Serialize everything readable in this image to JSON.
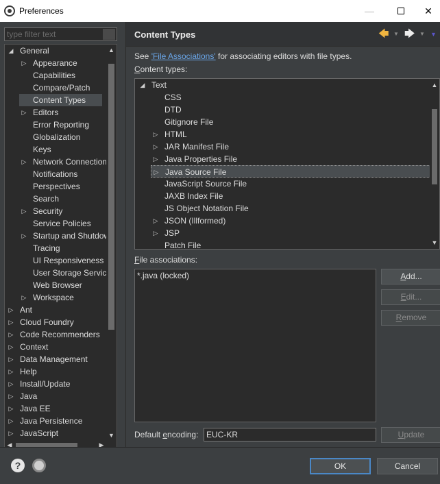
{
  "window": {
    "title": "Preferences",
    "minimize": "—",
    "close": "✕"
  },
  "filter": {
    "placeholder": "type filter text"
  },
  "tree": {
    "items": [
      {
        "label": "General",
        "expander": "expanded",
        "indent": 0
      },
      {
        "label": "Appearance",
        "expander": "collapsed",
        "indent": 1
      },
      {
        "label": "Capabilities",
        "expander": "none",
        "indent": 1
      },
      {
        "label": "Compare/Patch",
        "expander": "none",
        "indent": 1
      },
      {
        "label": "Content Types",
        "expander": "none",
        "indent": 1,
        "selected": true
      },
      {
        "label": "Editors",
        "expander": "collapsed",
        "indent": 1
      },
      {
        "label": "Error Reporting",
        "expander": "none",
        "indent": 1
      },
      {
        "label": "Globalization",
        "expander": "none",
        "indent": 1
      },
      {
        "label": "Keys",
        "expander": "none",
        "indent": 1
      },
      {
        "label": "Network Connections",
        "expander": "collapsed",
        "indent": 1
      },
      {
        "label": "Notifications",
        "expander": "none",
        "indent": 1
      },
      {
        "label": "Perspectives",
        "expander": "none",
        "indent": 1
      },
      {
        "label": "Search",
        "expander": "none",
        "indent": 1
      },
      {
        "label": "Security",
        "expander": "collapsed",
        "indent": 1
      },
      {
        "label": "Service Policies",
        "expander": "none",
        "indent": 1
      },
      {
        "label": "Startup and Shutdown",
        "expander": "collapsed",
        "indent": 1
      },
      {
        "label": "Tracing",
        "expander": "none",
        "indent": 1
      },
      {
        "label": "UI Responsiveness Monitoring",
        "expander": "none",
        "indent": 1
      },
      {
        "label": "User Storage Service",
        "expander": "none",
        "indent": 1
      },
      {
        "label": "Web Browser",
        "expander": "none",
        "indent": 1
      },
      {
        "label": "Workspace",
        "expander": "collapsed",
        "indent": 1
      },
      {
        "label": "Ant",
        "expander": "collapsed",
        "indent": 0
      },
      {
        "label": "Cloud Foundry",
        "expander": "collapsed",
        "indent": 0
      },
      {
        "label": "Code Recommenders",
        "expander": "collapsed",
        "indent": 0
      },
      {
        "label": "Context",
        "expander": "collapsed",
        "indent": 0
      },
      {
        "label": "Data Management",
        "expander": "collapsed",
        "indent": 0
      },
      {
        "label": "Help",
        "expander": "collapsed",
        "indent": 0
      },
      {
        "label": "Install/Update",
        "expander": "collapsed",
        "indent": 0
      },
      {
        "label": "Java",
        "expander": "collapsed",
        "indent": 0
      },
      {
        "label": "Java EE",
        "expander": "collapsed",
        "indent": 0
      },
      {
        "label": "Java Persistence",
        "expander": "collapsed",
        "indent": 0
      },
      {
        "label": "JavaScript",
        "expander": "collapsed",
        "indent": 0
      }
    ]
  },
  "page": {
    "title": "Content Types",
    "desc_prefix": "See ",
    "desc_link": "'File Associations'",
    "desc_suffix": " for associating editors with file types.",
    "content_types_label_u": "C",
    "content_types_label_rest": "ontent types:",
    "file_assoc_label_u": "F",
    "file_assoc_label_rest": "ile associations:",
    "encoding_label_pre": "Default ",
    "encoding_label_u": "e",
    "encoding_label_rest": "ncoding:",
    "encoding_value": "EUC-KR"
  },
  "content_types": [
    {
      "label": "Text",
      "expander": "expanded",
      "indent": 0
    },
    {
      "label": "CSS",
      "expander": "none",
      "indent": 1
    },
    {
      "label": "DTD",
      "expander": "none",
      "indent": 1
    },
    {
      "label": "Gitignore File",
      "expander": "none",
      "indent": 1
    },
    {
      "label": "HTML",
      "expander": "collapsed",
      "indent": 1
    },
    {
      "label": "JAR Manifest File",
      "expander": "collapsed",
      "indent": 1
    },
    {
      "label": "Java Properties File",
      "expander": "collapsed",
      "indent": 1
    },
    {
      "label": "Java Source File",
      "expander": "collapsed",
      "indent": 1,
      "selected": true
    },
    {
      "label": "JavaScript Source File",
      "expander": "none",
      "indent": 1
    },
    {
      "label": "JAXB Index File",
      "expander": "none",
      "indent": 1
    },
    {
      "label": "JS Object Notation File",
      "expander": "none",
      "indent": 1
    },
    {
      "label": "JSON (Illformed)",
      "expander": "collapsed",
      "indent": 1
    },
    {
      "label": "JSP",
      "expander": "collapsed",
      "indent": 1
    },
    {
      "label": "Patch File",
      "expander": "none",
      "indent": 1
    }
  ],
  "file_associations": [
    "*.java (locked)"
  ],
  "buttons": {
    "add_u": "A",
    "add_rest": "dd...",
    "edit_u": "E",
    "edit_rest": "dit...",
    "remove_u": "R",
    "remove_rest": "emove",
    "update_u": "U",
    "update_rest": "pdate",
    "ok": "OK",
    "cancel": "Cancel"
  },
  "icons": {
    "back": "arrow-left-icon",
    "forward": "arrow-right-icon",
    "help": "help-icon",
    "import_export": "preferences-import-icon"
  },
  "colors": {
    "background": "#3c3f41",
    "field": "#2b2b2b",
    "link": "#6aa6e8",
    "back_arrow": "#f0b540",
    "default_button_border": "#4a88c7"
  }
}
